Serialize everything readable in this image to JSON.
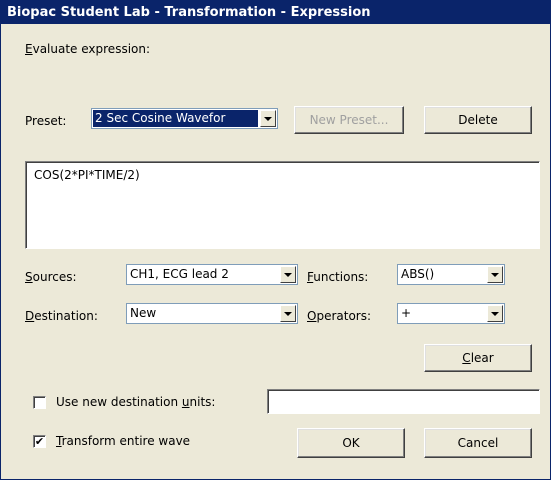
{
  "window": {
    "title": "Biopac Student Lab - Transformation - Expression"
  },
  "evaluate": {
    "label_pre": "",
    "label_mn": "E",
    "label_post": "valuate expression:"
  },
  "preset": {
    "label": "Preset:",
    "selected": "2 Sec Cosine Wavefor",
    "new_button": "New Preset...",
    "delete_button": "Delete"
  },
  "expression": {
    "value": "COS(2*PI*TIME/2)"
  },
  "sources": {
    "label_mn": "S",
    "label_post": "ources:",
    "selected": "CH1, ECG lead 2"
  },
  "functions": {
    "label_mn": "F",
    "label_post": "unctions:",
    "selected": "ABS()"
  },
  "destination": {
    "label_mn": "D",
    "label_post": "estination:",
    "selected": "New"
  },
  "operators": {
    "label_mn": "O",
    "label_post": "perators:",
    "selected": "+"
  },
  "clear": {
    "label_mn": "C",
    "label_post": "lear"
  },
  "units": {
    "label_pre": "Use new destination ",
    "label_mn": "u",
    "label_post": "nits:",
    "checked": false,
    "value": ""
  },
  "transform": {
    "label_mn": "T",
    "label_post": "ransform entire wave",
    "checked": true,
    "check_mark": "✔"
  },
  "ok_button": "OK",
  "cancel_button": "Cancel",
  "colors": {
    "titlebar": "#0a246a",
    "face": "#ece9d8",
    "selection": "#0a246a"
  }
}
